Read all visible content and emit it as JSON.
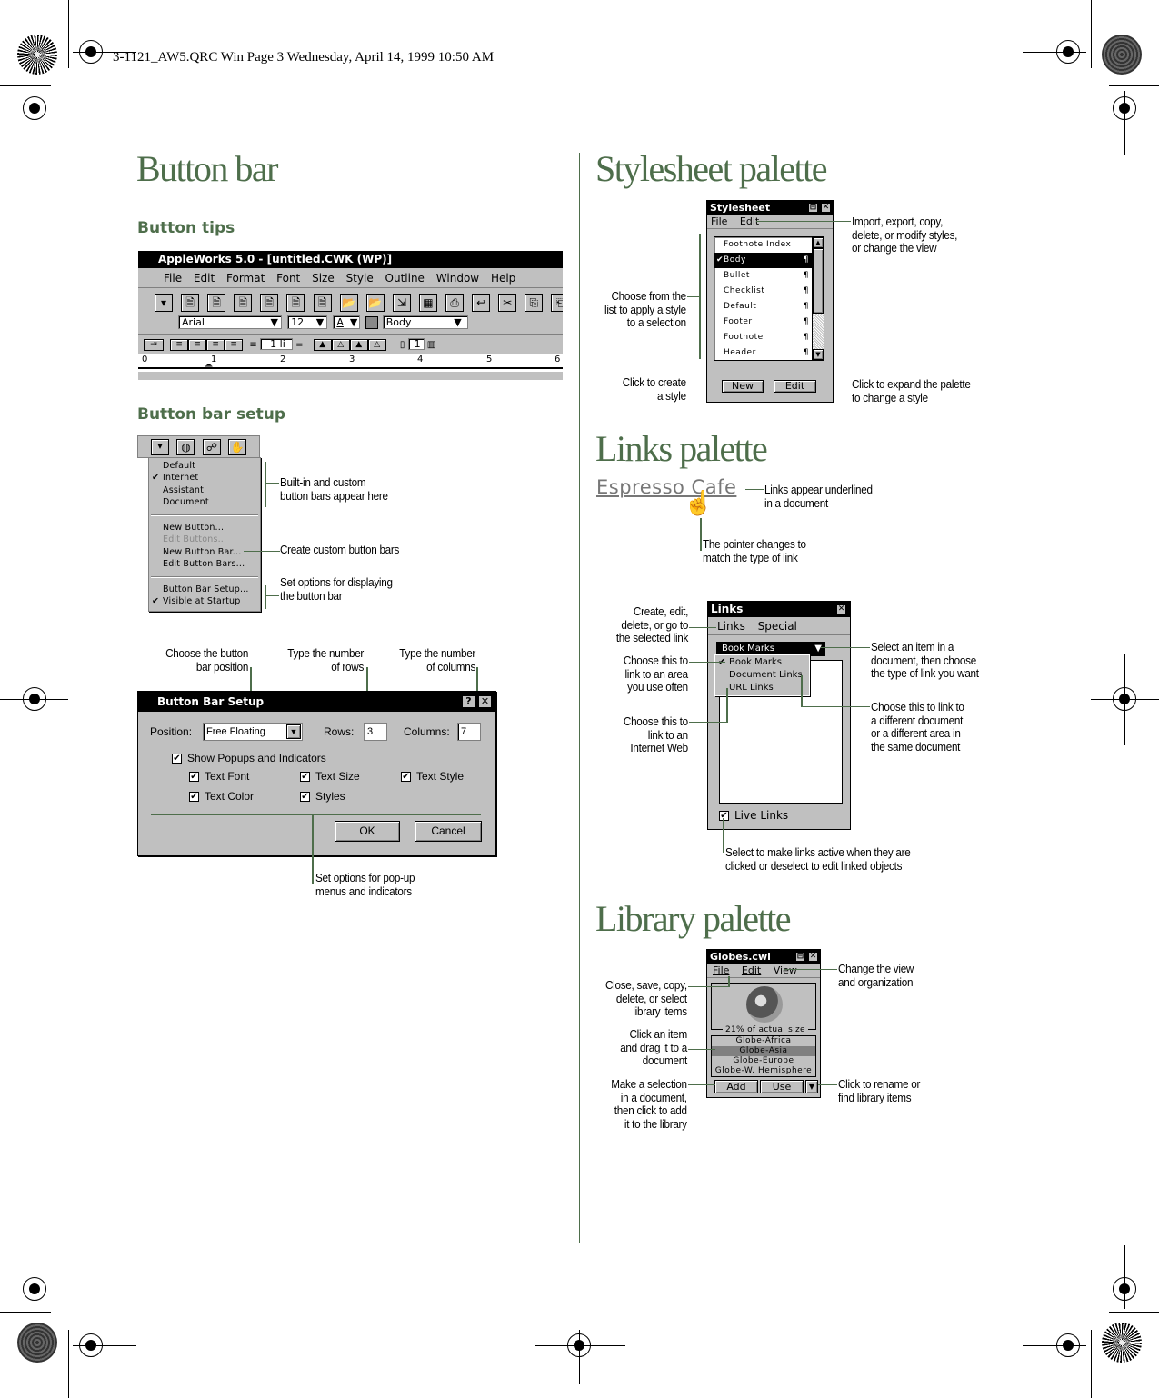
{
  "slug": "3-1121_AW5.QRC Win  Page 3  Wednesday, April 14, 1999  10:50 AM",
  "colors": {
    "heading": "#4e6e4b",
    "callout_line": "#4e6e4b",
    "title_bar": "#000000",
    "chrome": "#c0c0c0"
  },
  "left": {
    "title": "Button bar",
    "button_tips": {
      "heading": "Button tips",
      "window_title": "AppleWorks 5.0 - [untitled.CWK (WP)]",
      "menu": [
        "File",
        "Edit",
        "Format",
        "Font",
        "Size",
        "Style",
        "Outline",
        "Window",
        "Help"
      ],
      "font_value": "Arial",
      "size_value": "12",
      "color_value": "A",
      "style_value": "Body",
      "spacing_value": "1 li",
      "columns_value": "1",
      "ruler_ticks": [
        "0",
        "1",
        "2",
        "3",
        "4",
        "5",
        "6"
      ]
    },
    "setup": {
      "heading": "Button bar setup",
      "menu_items": [
        {
          "label": "Default",
          "checked": false,
          "disabled": false
        },
        {
          "label": "Internet",
          "checked": true,
          "disabled": false
        },
        {
          "label": "Assistant",
          "checked": false,
          "disabled": false
        },
        {
          "label": "Document",
          "checked": false,
          "disabled": false
        },
        {
          "label": "New Button...",
          "checked": false,
          "disabled": false
        },
        {
          "label": "Edit Buttons...",
          "checked": false,
          "disabled": true
        },
        {
          "label": "New Button Bar...",
          "checked": false,
          "disabled": false
        },
        {
          "label": "Edit Button Bars...",
          "checked": false,
          "disabled": false
        },
        {
          "label": "Button Bar Setup...",
          "checked": false,
          "disabled": false
        },
        {
          "label": "Visible at Startup",
          "checked": true,
          "disabled": false
        }
      ],
      "callouts": {
        "builtin": "Built-in and custom\nbutton bars appear here",
        "create": "Create custom button bars",
        "options": "Set options for displaying\nthe button bar"
      }
    },
    "dialog": {
      "title": "Button Bar Setup",
      "help_btn": "?",
      "close_btn": "✕",
      "position_label": "Position:",
      "position_value": "Free Floating",
      "rows_label": "Rows:",
      "rows_value": "3",
      "columns_label": "Columns:",
      "columns_value": "7",
      "show_popups": "Show Popups and Indicators",
      "checks": [
        "Text Font",
        "Text Size",
        "Text Style",
        "Text Color",
        "Styles"
      ],
      "ok": "OK",
      "cancel": "Cancel",
      "callouts": {
        "position": "Choose the button\nbar position",
        "rows": "Type the number\nof rows",
        "columns": "Type the number\nof columns",
        "popups": "Set options for pop-up\nmenus and indicators"
      }
    }
  },
  "right": {
    "stylesheet": {
      "title": "Stylesheet palette",
      "window_title": "Stylesheet",
      "menu": [
        "File",
        "Edit"
      ],
      "styles": [
        {
          "name": "Footnote Index",
          "pilcrow": false,
          "selected": false
        },
        {
          "name": "Body",
          "pilcrow": true,
          "selected": true
        },
        {
          "name": "Bullet",
          "pilcrow": true,
          "selected": false
        },
        {
          "name": "Checklist",
          "pilcrow": true,
          "selected": false
        },
        {
          "name": "Default",
          "pilcrow": true,
          "selected": false
        },
        {
          "name": "Footer",
          "pilcrow": true,
          "selected": false
        },
        {
          "name": "Footnote",
          "pilcrow": true,
          "selected": false
        },
        {
          "name": "Header",
          "pilcrow": true,
          "selected": false
        }
      ],
      "new_btn": "New",
      "edit_btn": "Edit",
      "callouts": {
        "menu": "Import, export, copy,\ndelete, or modify styles,\nor change the view",
        "list": "Choose from the\nlist to apply a style\nto a selection",
        "new": "Click to create\na style",
        "edit": "Click to expand the palette\nto change a style"
      }
    },
    "links": {
      "title": "Links palette",
      "sample_link": "Espresso Cafe",
      "window_title": "Links",
      "menu": [
        "Links",
        "Special"
      ],
      "popup_value": "Book Marks",
      "popup_items": [
        {
          "label": "Book Marks",
          "checked": true
        },
        {
          "label": "Document Links",
          "checked": false
        },
        {
          "label": "URL Links",
          "checked": false
        }
      ],
      "live_links": "Live Links",
      "callouts": {
        "underlined": "Links appear underlined\nin a document",
        "pointer": "The pointer changes to\nmatch the type of link",
        "menu": "Create, edit,\ndelete, or go to\nthe selected link",
        "bookmarks": "Choose this to\nlink to an area\nyou use often",
        "url": "Choose this to\nlink to an\nInternet Web",
        "popup": "Select an item in a\ndocument, then choose\nthe type of link you want",
        "doclinks": "Choose this to link to\na different document\nor a different area in\nthe same document",
        "live": "Select to make links active when they are\nclicked or deselect to edit linked objects"
      }
    },
    "library": {
      "title": "Library palette",
      "window_title": "Globes.cwl",
      "menu": [
        "File",
        "Edit",
        "View"
      ],
      "preview_caption": "21% of actual size",
      "items": [
        {
          "name": "Globe-Africa",
          "selected": false
        },
        {
          "name": "Globe-Asia",
          "selected": true
        },
        {
          "name": "Globe-Europe",
          "selected": false
        },
        {
          "name": "Globe-W. Hemisphere",
          "selected": false
        }
      ],
      "add_btn": "Add",
      "use_btn": "Use",
      "callouts": {
        "view": "Change the view\nand organization",
        "file": "Close, save, copy,\ndelete, or select\nlibrary items",
        "drag": "Click an item\nand drag it to a\ndocument",
        "add": "Make a selection\nin a document,\nthen click to add\nit to the library",
        "rename": "Click to rename or\nfind library items"
      }
    }
  }
}
